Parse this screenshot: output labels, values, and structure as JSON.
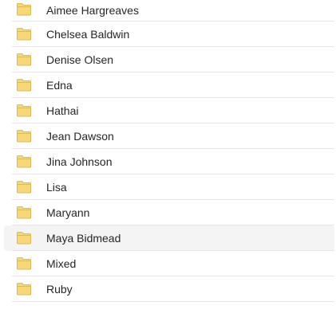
{
  "folders": [
    {
      "name": "Aimee Hargreaves",
      "icon": "folder-icon"
    },
    {
      "name": "Chelsea Baldwin",
      "icon": "folder-icon"
    },
    {
      "name": "Denise Olsen",
      "icon": "folder-icon"
    },
    {
      "name": "Edna",
      "icon": "folder-icon"
    },
    {
      "name": "Hathai",
      "icon": "folder-icon"
    },
    {
      "name": "Jean Dawson",
      "icon": "folder-icon"
    },
    {
      "name": "Jina Johnson",
      "icon": "folder-icon"
    },
    {
      "name": "Lisa",
      "icon": "folder-icon"
    },
    {
      "name": "Maryann",
      "icon": "folder-icon"
    },
    {
      "name": "Maya Bidmead",
      "icon": "folder-icon",
      "hovered": true
    },
    {
      "name": "Mixed",
      "icon": "folder-icon"
    },
    {
      "name": "Ruby",
      "icon": "folder-icon"
    }
  ],
  "colors": {
    "folder_fill": "#f6d77a",
    "folder_outline": "#e0b94c",
    "row_hover": "#f4f4f4",
    "divider": "#e6e6e6"
  }
}
